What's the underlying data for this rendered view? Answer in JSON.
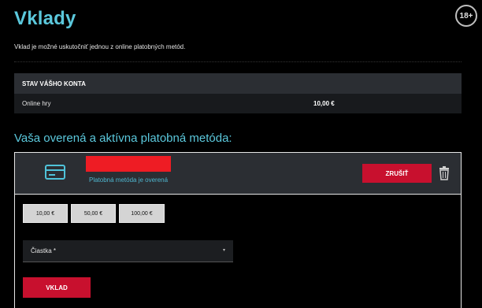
{
  "header": {
    "title": "Vklady",
    "age_badge": "18+",
    "intro": "Vklad je možné uskutočniť jednou z online platobných metód."
  },
  "account": {
    "heading": "STAV VÁŠHO KONTA",
    "rows": [
      {
        "label": "Online hry",
        "value": "10,00 €"
      }
    ]
  },
  "payment": {
    "section_title": "Vaša overená a aktívna platobná metóda:",
    "method_status": "Platobná metóda je overená",
    "cancel_label": "ZRUŠIŤ",
    "icons": {
      "card": "credit-card-icon",
      "delete": "trash-icon"
    },
    "redaction_color": "#ee1c24"
  },
  "deposit": {
    "amounts": [
      "10,00 €",
      "50,00 €",
      "100,00 €"
    ],
    "amount_placeholder": "Čiastka *",
    "submit_label": "VKLAD"
  },
  "colors": {
    "accent": "#5bc8dc",
    "button": "#c8102e",
    "panel": "#2b2e33"
  }
}
